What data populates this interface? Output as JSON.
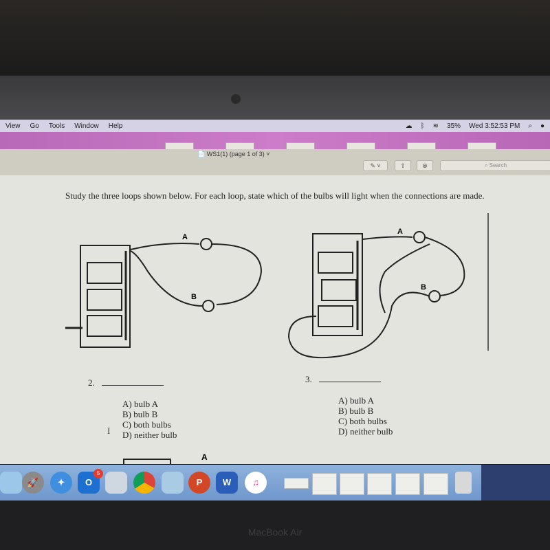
{
  "menubar": {
    "items": [
      "View",
      "Go",
      "Tools",
      "Window",
      "Help"
    ],
    "battery": "35%",
    "clock": "Wed 3:52:53 PM"
  },
  "toolbar": {
    "document_title": "WS1(1) (page 1 of 3)",
    "search_placeholder": "Search"
  },
  "document": {
    "prompt": "Study the three loops shown below. For each loop, state which of the bulbs will light when the connections are made.",
    "circuit_labels": {
      "a": "A",
      "b": "B"
    },
    "questions": [
      {
        "number": "2.",
        "choices": [
          "A) bulb A",
          "B) bulb B",
          "C) both bulbs",
          "D) neither bulb"
        ]
      },
      {
        "number": "3.",
        "choices": [
          "A) bulb A",
          "B) bulb B",
          "C) both bulbs",
          "D) neither bulb"
        ]
      }
    ],
    "next_label": "A"
  },
  "dock": {
    "apps": [
      "finder",
      "launchpad",
      "safari",
      "outlook",
      "preview",
      "chrome",
      "photos",
      "powerpoint",
      "word",
      "itunes"
    ],
    "outlook_badge": "5",
    "letters": {
      "outlook": "O",
      "powerpoint": "P",
      "word": "W"
    }
  },
  "bezel": {
    "brand": "MacBook Air"
  }
}
